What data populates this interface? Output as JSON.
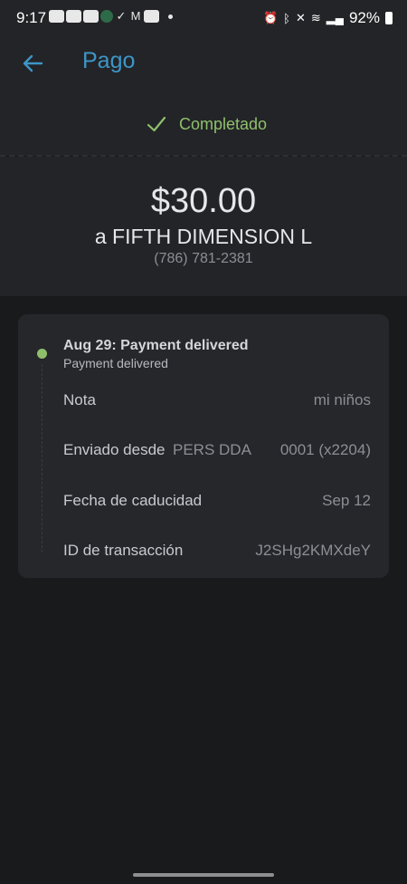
{
  "status_bar": {
    "time": "9:17",
    "battery": "92%",
    "left_icons": [
      "chat-icon",
      "youtube-icon",
      "youtube-icon",
      "b-app-icon",
      "check-circle-icon",
      "gmail-icon",
      "youtube-icon",
      "dot-icon"
    ],
    "right_icons": [
      "alarm-icon",
      "bluetooth-icon",
      "mute-icon",
      "wifi-icon",
      "signal-icon",
      "battery-icon"
    ]
  },
  "header": {
    "title": "Pago",
    "back_icon": "arrow-left-icon",
    "accent_color": "#3d96c8"
  },
  "status": {
    "icon": "check-icon",
    "text": "Completado",
    "color": "#8ec06c"
  },
  "payment": {
    "amount": "$30.00",
    "recipient": "a FIFTH DIMENSION L",
    "phone": "(786) 781-2381"
  },
  "details": {
    "event": {
      "title": "Aug 29: Payment delivered",
      "subtitle": "Payment delivered"
    },
    "rows": [
      {
        "label": "Nota",
        "value": "mi niños"
      },
      {
        "label": "Enviado desde",
        "mid": "PERS DDA",
        "value": "0001 (x2204)"
      },
      {
        "label": "Fecha de caducidad",
        "value": "Sep 12"
      },
      {
        "label": "ID de transacción",
        "value": "J2SHg2KMXdeY"
      }
    ]
  }
}
